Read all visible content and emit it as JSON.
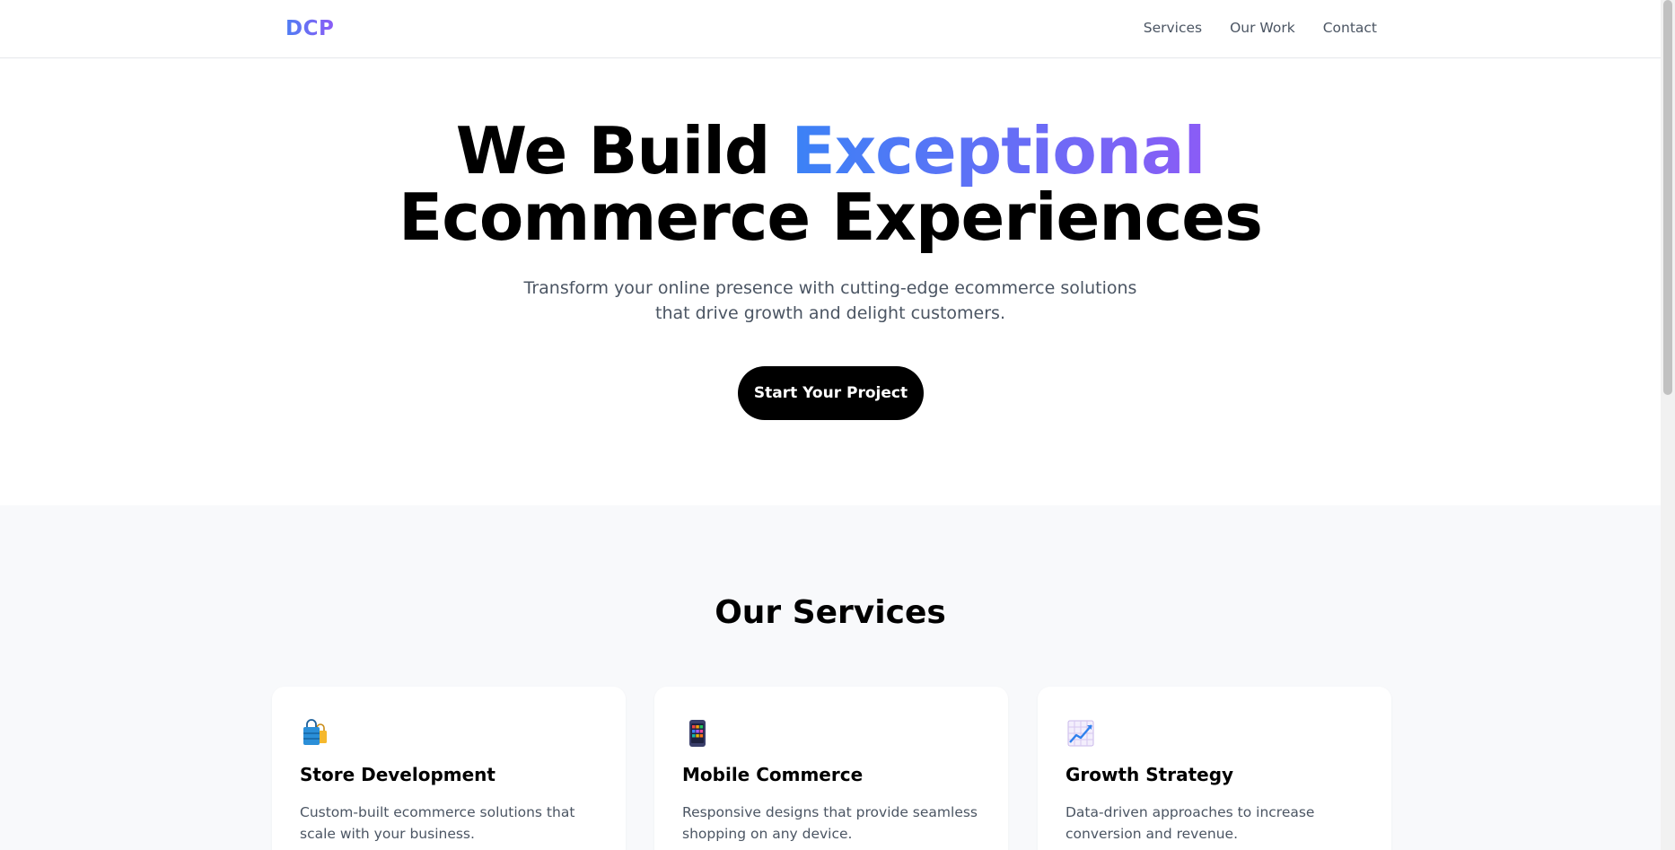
{
  "header": {
    "logo": "DCP",
    "nav": [
      {
        "label": "Services"
      },
      {
        "label": "Our Work"
      },
      {
        "label": "Contact"
      }
    ]
  },
  "hero": {
    "title_part1": "We Build ",
    "title_accent": "Exceptional",
    "title_part2": "Ecommerce Experiences",
    "subtitle": "Transform your online presence with cutting-edge ecommerce solutions that drive growth and delight customers.",
    "cta_label": "Start Your Project"
  },
  "services": {
    "title": "Our Services",
    "cards": [
      {
        "icon": "shopping-bags-icon",
        "title": "Store Development",
        "desc": "Custom-built ecommerce solutions that scale with your business."
      },
      {
        "icon": "mobile-phone-icon",
        "title": "Mobile Commerce",
        "desc": "Responsive designs that provide seamless shopping on any device."
      },
      {
        "icon": "chart-increasing-icon",
        "title": "Growth Strategy",
        "desc": "Data-driven approaches to increase conversion and revenue."
      }
    ]
  },
  "colors": {
    "accent_start": "#3b82f6",
    "accent_end": "#8b5cf6",
    "cta_bg": "#000000",
    "section_bg": "#f8f9fb"
  }
}
